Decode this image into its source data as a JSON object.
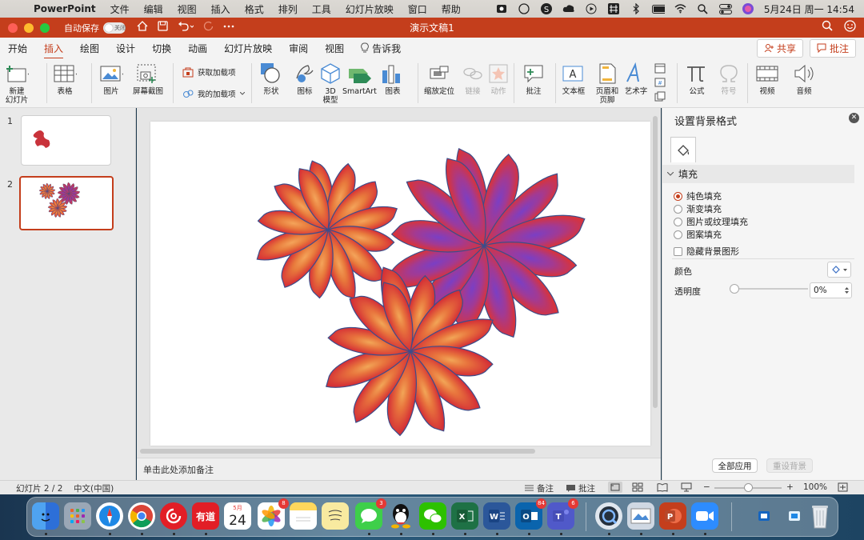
{
  "menubar": {
    "app": "PowerPoint",
    "items": [
      "文件",
      "编辑",
      "视图",
      "插入",
      "格式",
      "排列",
      "工具",
      "幻灯片放映",
      "窗口",
      "帮助"
    ],
    "datetime": "5月24日 周一  14:54"
  },
  "titlebar": {
    "autosave_label": "自动保存",
    "autosave_state": "关闭",
    "doc_title": "演示文稿1"
  },
  "tabs": {
    "items": [
      "开始",
      "插入",
      "绘图",
      "设计",
      "切换",
      "动画",
      "幻灯片放映",
      "审阅",
      "视图"
    ],
    "active": "插入",
    "tell_me": "告诉我",
    "share": "共享",
    "comments": "批注"
  },
  "ribbon": {
    "new_slide": "新建\n幻灯片",
    "table": "表格",
    "picture": "图片",
    "screenshot": "屏幕截图",
    "get_addins": "获取加载项",
    "my_addins": "我的加载项",
    "shapes": "形状",
    "icons": "图标",
    "model3d": "3D\n模型",
    "smartart": "SmartArt",
    "chart": "图表",
    "zoom": "缩放定位",
    "link": "链接",
    "action": "动作",
    "comment": "批注",
    "textbox": "文本框",
    "header_footer": "页眉和\n页脚",
    "wordart": "艺术字",
    "equation": "公式",
    "symbol": "符号",
    "video": "视频",
    "audio": "音频"
  },
  "slides": {
    "numbers": [
      "1",
      "2"
    ],
    "selected": 2
  },
  "notes_placeholder": "单击此处添加备注",
  "format_pane": {
    "title": "设置背景格式",
    "section": "填充",
    "options": [
      "纯色填充",
      "渐变填充",
      "图片或纹理填充",
      "图案填充"
    ],
    "selected_option": "纯色填充",
    "hide_bg_graphics": "隐藏背景图形",
    "color_label": "颜色",
    "transparency_label": "透明度",
    "transparency_value": "0%",
    "transparency_fraction": 0,
    "apply_all": "全部应用",
    "reset": "重设背景"
  },
  "statusbar": {
    "slide_info": "幻灯片 2 / 2",
    "language": "中文(中国)",
    "notes": "备注",
    "comments": "批注",
    "zoom": "100%",
    "zoom_fraction": 0.5
  },
  "dock": {
    "badges": {
      "photos": "8",
      "messages": "3",
      "outlook": "84",
      "teams": "6"
    },
    "calendar_month": "5月",
    "calendar_day": "24",
    "youdao": "有道"
  },
  "colors": {
    "accent": "#c43e1c",
    "flower_orange": "#f09a3e",
    "flower_red": "#d83a3a",
    "flower_purple": "#7a3bbf",
    "outline": "#3d4d8a"
  }
}
